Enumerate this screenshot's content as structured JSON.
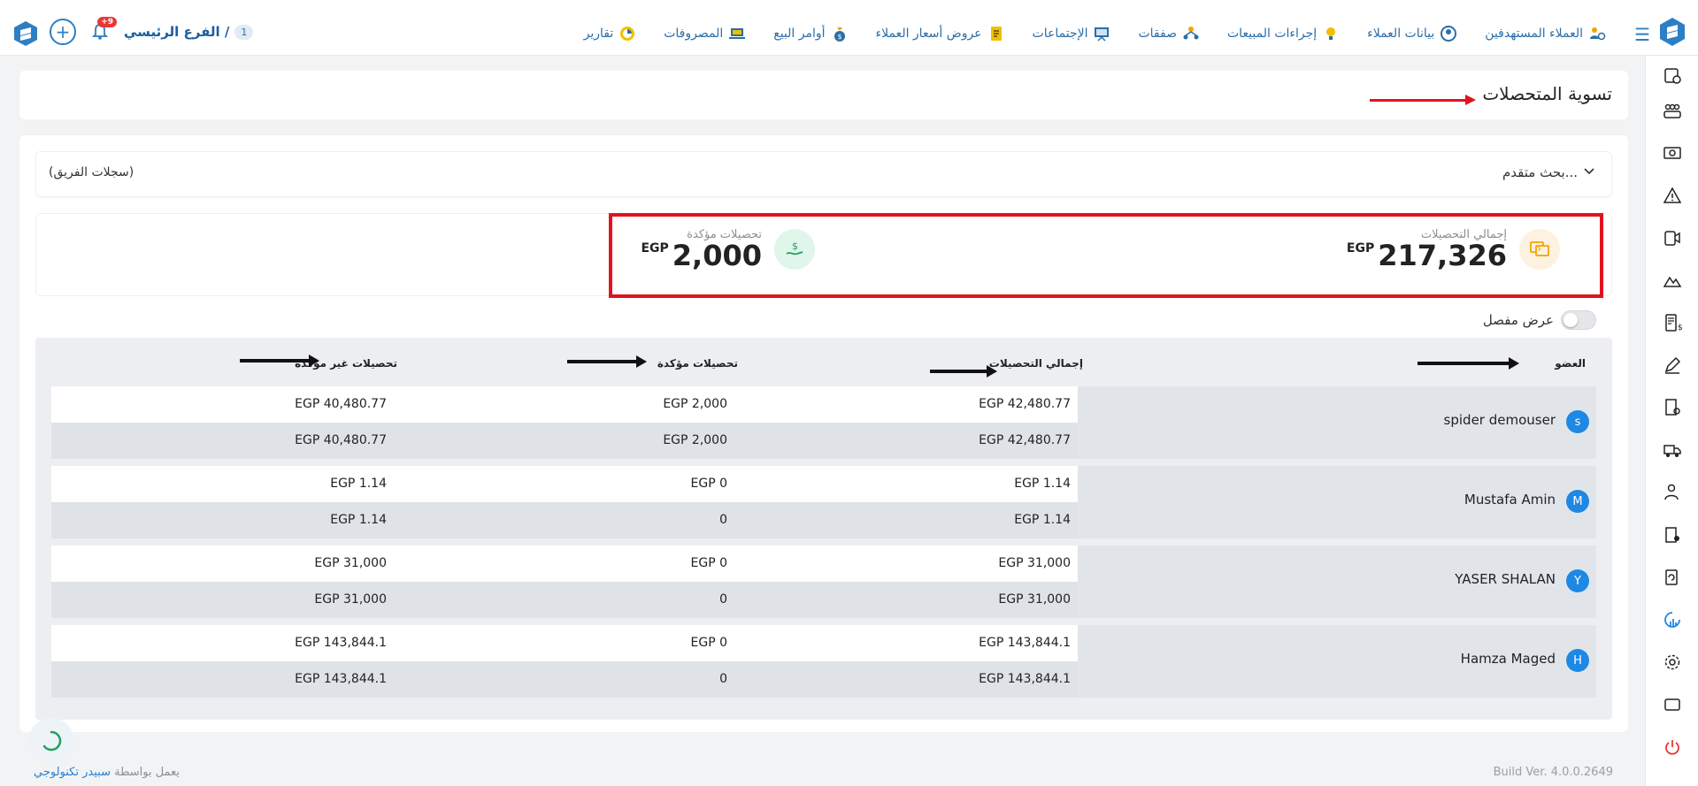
{
  "topbar": {
    "branch_label": "الفرع الرئيسي /",
    "branch_count": "1",
    "notification_count": "+9",
    "nav": [
      {
        "label": "العملاء المستهدفين",
        "icon": "people-target-icon"
      },
      {
        "label": "بيانات العملاء",
        "icon": "client-data-icon"
      },
      {
        "label": "إجراءات المبيعات",
        "icon": "lightbulb-icon"
      },
      {
        "label": "صفقات",
        "icon": "deals-icon"
      },
      {
        "label": "الإجتماعات",
        "icon": "presentation-icon"
      },
      {
        "label": "عروض أسعار العملاء",
        "icon": "quote-icon"
      },
      {
        "label": "أوامر البيع",
        "icon": "money-bag-icon"
      },
      {
        "label": "المصروفات",
        "icon": "laptop-icon"
      },
      {
        "label": "تقارير",
        "icon": "report-icon"
      }
    ]
  },
  "page": {
    "title": "تسوية المتحصلات"
  },
  "search": {
    "advanced_label": "بحث متقدم...",
    "team_records_label": "(سجلات الفريق)"
  },
  "summary": {
    "total_label": "إجمالي التحصيلات",
    "total_value": "217,326",
    "total_currency": "EGP",
    "confirmed_label": "تحصيلات مؤكدة",
    "confirmed_value": "2,000",
    "confirmed_currency": "EGP"
  },
  "toggle": {
    "label": "عرض مفصل"
  },
  "table": {
    "headers": {
      "member": "العضو",
      "total": "إجمالي التحصيلات",
      "confirmed": "تحصيلات مؤكدة",
      "unconfirmed": "تحصيلات غير مؤكدة"
    },
    "rows": [
      {
        "name": "spider demouser",
        "initial": "s",
        "r1": {
          "total": "EGP 42,480.77",
          "confirmed": "EGP 2,000",
          "unconfirmed": "EGP 40,480.77"
        },
        "r2": {
          "total": "EGP 42,480.77",
          "confirmed": "EGP 2,000",
          "unconfirmed": "EGP 40,480.77"
        }
      },
      {
        "name": "Mustafa Amin",
        "initial": "M",
        "r1": {
          "total": "EGP 1.14",
          "confirmed": "EGP 0",
          "unconfirmed": "EGP 1.14"
        },
        "r2": {
          "total": "EGP 1.14",
          "confirmed": "0",
          "unconfirmed": "EGP 1.14"
        }
      },
      {
        "name": "YASER SHALAN",
        "initial": "Y",
        "r1": {
          "total": "EGP 31,000",
          "confirmed": "EGP 0",
          "unconfirmed": "EGP 31,000"
        },
        "r2": {
          "total": "EGP 31,000",
          "confirmed": "0",
          "unconfirmed": "EGP 31,000"
        }
      },
      {
        "name": "Hamza Maged",
        "initial": "H",
        "r1": {
          "total": "EGP 143,844.1",
          "confirmed": "EGP 0",
          "unconfirmed": "EGP 143,844.1"
        },
        "r2": {
          "total": "EGP 143,844.1",
          "confirmed": "0",
          "unconfirmed": "EGP 143,844.1"
        }
      }
    ]
  },
  "footer": {
    "powered_prefix": "يعمل بواسطة",
    "powered_brand": "سبيدر تكنولوجي",
    "build": "Build Ver. 4.0.0.2649"
  },
  "colors": {
    "accent": "#2b6ea8",
    "avatar": "#1e88e5",
    "highlight": "#e0141d"
  }
}
